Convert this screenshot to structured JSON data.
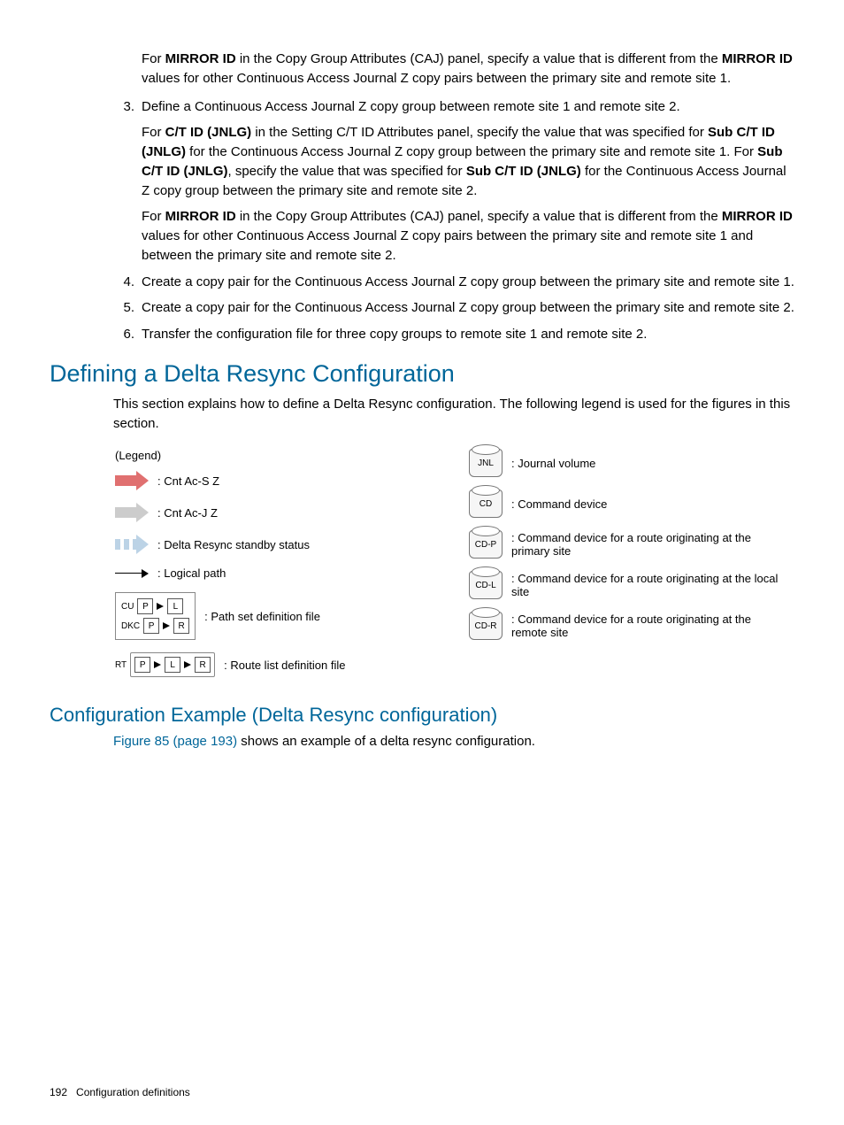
{
  "para_intro": "For ",
  "b_mirror": "MIRROR ID",
  "para_intro2": " in the Copy Group Attributes (CAJ) panel, specify a value that is different from the ",
  "para_intro3": " values for other Continuous Access Journal Z copy pairs between the primary site and remote site 1.",
  "steps": [
    {
      "num": "3.",
      "lead": "Define a Continuous Access Journal Z copy group between remote site 1 and remote site 2.",
      "p2a": "For ",
      "b_ctid": "C/T ID (JNLG)",
      "p2b": " in the Setting C/T ID Attributes panel, specify the value that was specified for ",
      "b_subctid": "Sub C/T ID (JNLG)",
      "p2c": " for the Continuous Access Journal Z copy group between the primary site and remote site 1. For ",
      "p2d": ", specify the value that was specified for ",
      "p2e": " for the Continuous Access Journal Z copy group between the primary site and remote site 2.",
      "p3a": "For ",
      "p3b": " in the Copy Group Attributes (CAJ) panel, specify a value that is different from the ",
      "p3c": " values for other Continuous Access Journal Z copy pairs between the primary site and remote site 1 and between the primary site and remote site 2."
    },
    {
      "num": "4.",
      "lead": "Create a copy pair for the Continuous Access Journal Z copy group between the primary site and remote site 1."
    },
    {
      "num": "5.",
      "lead": "Create a copy pair for the Continuous Access Journal Z copy group between the primary site and remote site 2."
    },
    {
      "num": "6.",
      "lead": "Transfer the configuration file for three copy groups to remote site 1 and remote site 2."
    }
  ],
  "h2": "Defining a Delta Resync Configuration",
  "h2_body": "This section explains how to define a Delta Resync configuration. The following legend is used for the figures in this section.",
  "legend": {
    "title": "(Legend)",
    "left": [
      ": Cnt Ac-S Z",
      ": Cnt Ac-J Z",
      ": Delta Resync standby status",
      ": Logical path",
      ": Path set definition file",
      ": Route list definition file"
    ],
    "right_labels": [
      "JNL",
      "CD",
      "CD-P",
      "CD-L",
      "CD-R"
    ],
    "right": [
      ": Journal volume",
      ": Command device",
      ": Command device for a route originating at the primary site",
      ": Command device for a route originating at the local site",
      ": Command device for a route originating at the remote site"
    ],
    "mini": {
      "cu": "CU",
      "dkc": "DKC",
      "rt": "RT",
      "p": "P",
      "l": "L",
      "r": "R"
    }
  },
  "h3": "Configuration Example (Delta Resync configuration)",
  "h3_link": "Figure 85 (page 193)",
  "h3_rest": " shows an example of a delta resync configuration.",
  "footer_page": "192",
  "footer_title": "Configuration definitions"
}
